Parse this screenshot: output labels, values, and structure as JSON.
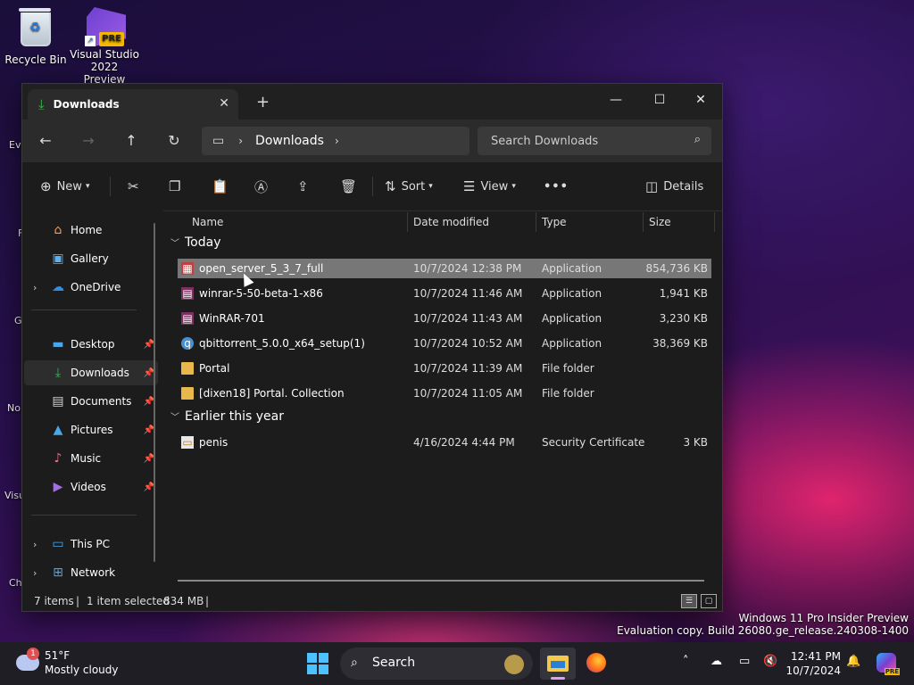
{
  "desktop": {
    "icons": [
      {
        "label": "Recycle Bin"
      },
      {
        "label": "Visual Studio 2022 Preview",
        "badge": "PRE"
      }
    ],
    "edge_fragments": [
      "Ev",
      "F",
      "G",
      "No",
      "Visu",
      "Ch"
    ]
  },
  "window": {
    "tab_title": "Downloads",
    "address": {
      "crumb": "Downloads"
    },
    "search_placeholder": "Search Downloads",
    "toolbar": {
      "new_label": "New",
      "sort_label": "Sort",
      "view_label": "View",
      "more_label": "•••",
      "details_label": "Details"
    },
    "sidebar": {
      "items": [
        {
          "label": "Home"
        },
        {
          "label": "Gallery"
        },
        {
          "label": "OneDrive"
        },
        {
          "label": "Desktop"
        },
        {
          "label": "Downloads"
        },
        {
          "label": "Documents"
        },
        {
          "label": "Pictures"
        },
        {
          "label": "Music"
        },
        {
          "label": "Videos"
        },
        {
          "label": "This PC"
        },
        {
          "label": "Network"
        }
      ]
    },
    "columns": {
      "name": "Name",
      "date": "Date modified",
      "type": "Type",
      "size": "Size"
    },
    "groups": {
      "today": "Today",
      "earlier": "Earlier this year"
    },
    "files": [
      {
        "name": "open_server_5_3_7_full",
        "date": "10/7/2024 12:38 PM",
        "type": "Application",
        "size": "854,736 KB"
      },
      {
        "name": "winrar-5-50-beta-1-x86",
        "date": "10/7/2024 11:46 AM",
        "type": "Application",
        "size": "1,941 KB"
      },
      {
        "name": "WinRAR-701",
        "date": "10/7/2024 11:43 AM",
        "type": "Application",
        "size": "3,230 KB"
      },
      {
        "name": "qbittorrent_5.0.0_x64_setup(1)",
        "date": "10/7/2024 10:52 AM",
        "type": "Application",
        "size": "38,369 KB"
      },
      {
        "name": "Portal",
        "date": "10/7/2024 11:39 AM",
        "type": "File folder",
        "size": ""
      },
      {
        "name": "[dixen18] Portal. Collection",
        "date": "10/7/2024 11:05 AM",
        "type": "File folder",
        "size": ""
      },
      {
        "name": "penis",
        "date": "4/16/2024 4:44 PM",
        "type": "Security Certificate",
        "size": "3 KB"
      }
    ],
    "status": {
      "items": "7 items",
      "selected": "1 item selected",
      "size": "834 MB"
    }
  },
  "watermark": {
    "line1": "Windows 11 Pro Insider Preview",
    "line2": "Evaluation copy. Build 26080.ge_release.240308-1400"
  },
  "taskbar": {
    "weather": {
      "temp": "51°F",
      "condition": "Mostly cloudy",
      "badge": "1"
    },
    "search_label": "Search",
    "clock": {
      "time": "12:41 PM",
      "date": "10/7/2024"
    },
    "copilot_badge": "PRE"
  },
  "colors": {
    "accent": "#4cc2ff",
    "download_green": "#3fb950",
    "folder": "#e8b84a",
    "selection": "#777777"
  }
}
